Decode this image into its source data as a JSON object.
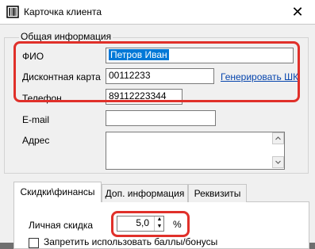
{
  "window": {
    "title": "Карточка клиента",
    "close_glyph": "✕"
  },
  "group": {
    "title": "Общая информация",
    "fio_label": "ФИО",
    "fio_value": "Петров Иван",
    "card_label": "Дисконтная карта",
    "card_value": "00112233",
    "generate_link": "Генерировать ШК",
    "phone_label": "Телефон",
    "phone_value": "89112223344",
    "email_label": "E-mail",
    "email_value": "",
    "address_label": "Адрес",
    "address_value": ""
  },
  "tabs": [
    {
      "label": "Скидки\\финансы",
      "active": true
    },
    {
      "label": "Доп. информация",
      "active": false
    },
    {
      "label": "Реквизиты",
      "active": false
    }
  ],
  "discount": {
    "label": "Личная скидка",
    "value": "5,0",
    "unit": "%",
    "checkbox_label": "Запретить использовать баллы/бонусы"
  },
  "colors": {
    "highlight": "#e0302a",
    "selection": "#0078d7",
    "link": "#0645ad"
  }
}
